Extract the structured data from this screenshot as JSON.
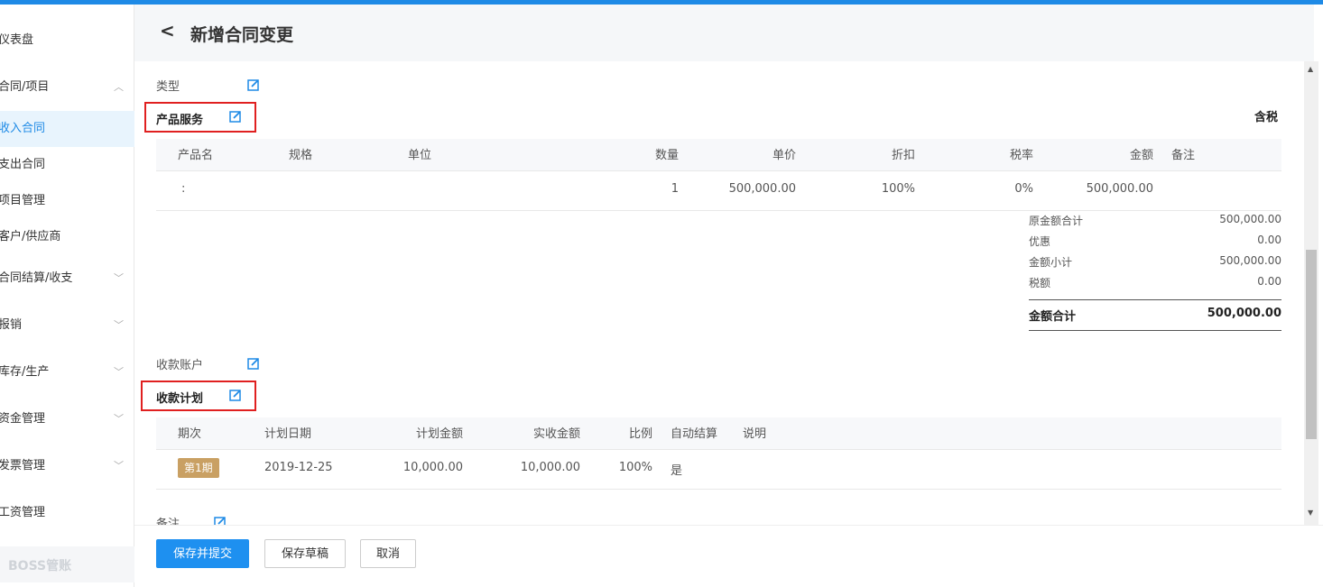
{
  "sidebar": {
    "items": [
      {
        "label": "仪表盘",
        "chevron": ""
      },
      {
        "label": "合同/项目",
        "chevron": "^"
      },
      {
        "label": "收入合同",
        "chevron": ""
      },
      {
        "label": "支出合同",
        "chevron": ""
      },
      {
        "label": "项目管理",
        "chevron": ""
      },
      {
        "label": "客户/供应商",
        "chevron": ""
      },
      {
        "label": "合同结算/收支",
        "chevron": "v"
      },
      {
        "label": "报销",
        "chevron": "v"
      },
      {
        "label": "库存/生产",
        "chevron": "v"
      },
      {
        "label": "资金管理",
        "chevron": "v"
      },
      {
        "label": "发票管理",
        "chevron": "v"
      },
      {
        "label": "工资管理",
        "chevron": ""
      }
    ],
    "footer": "BOSS管账"
  },
  "header": {
    "back": "<",
    "title": "新增合同变更"
  },
  "sections": {
    "type_label": "类型",
    "product_title": "产品服务",
    "tax_label": "含税",
    "account_label": "收款账户",
    "plan_title": "收款计划",
    "remark_label": "备注"
  },
  "product_table": {
    "headers": [
      "产品名",
      "规格",
      "单位",
      "数量",
      "单价",
      "折扣",
      "税率",
      "金额",
      "备注"
    ],
    "row": {
      "name": ":",
      "spec": "",
      "unit": "",
      "qty": "1",
      "price": "500,000.00",
      "discount": "100%",
      "tax": "0%",
      "amount": "500,000.00",
      "remark": ""
    }
  },
  "summary": {
    "items": [
      {
        "label": "原金额合计",
        "value": "500,000.00"
      },
      {
        "label": "优惠",
        "value": "0.00"
      },
      {
        "label": "金额小计",
        "value": "500,000.00"
      },
      {
        "label": "税额",
        "value": "0.00"
      }
    ],
    "total_label": "金额合计",
    "total_value": "500,000.00"
  },
  "plan_table": {
    "headers": [
      "期次",
      "计划日期",
      "计划金额",
      "实收金额",
      "比例",
      "自动结算",
      "说明"
    ],
    "row": {
      "period": "第1期",
      "date": "2019-12-25",
      "planned": "10,000.00",
      "received": "10,000.00",
      "ratio": "100%",
      "auto": "是",
      "note": ""
    }
  },
  "footer": {
    "submit": "保存并提交",
    "draft": "保存草稿",
    "cancel": "取消"
  },
  "colors": {
    "accent": "#1e8ae6",
    "highlight_box": "#e02020",
    "period_tag": "#c9a063"
  }
}
